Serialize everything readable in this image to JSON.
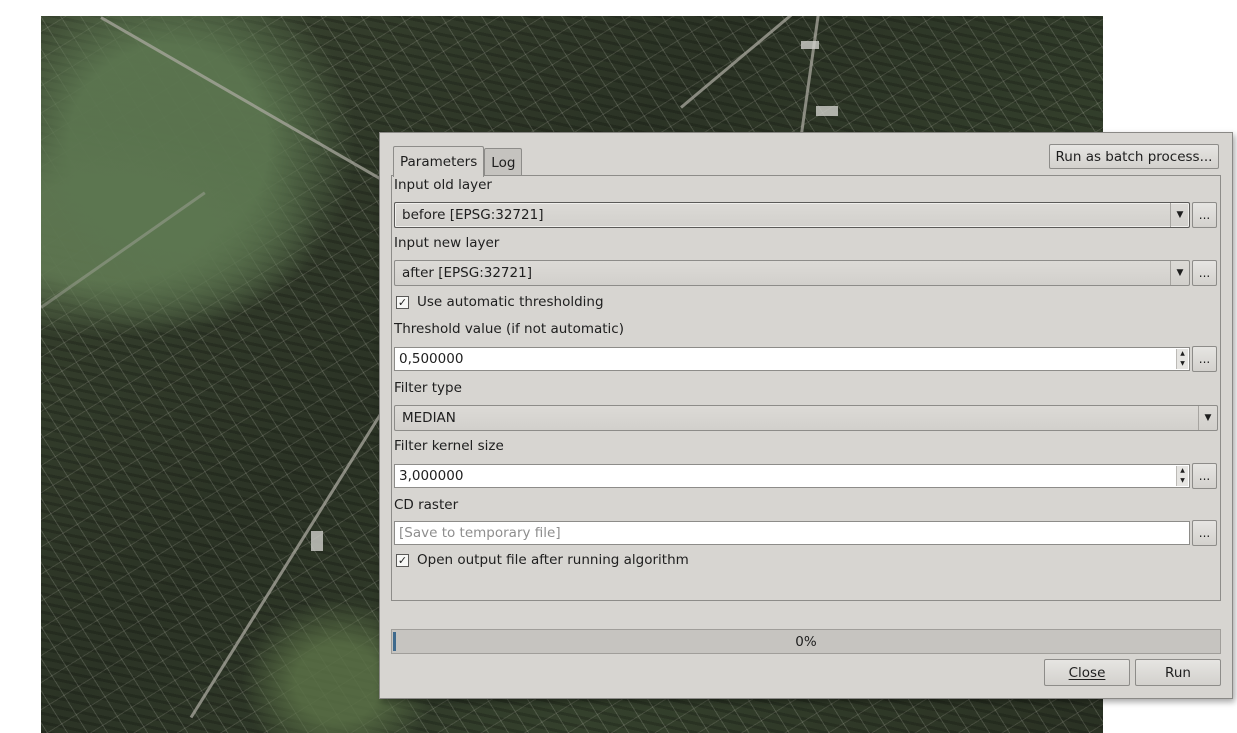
{
  "tabs": [
    {
      "label": "Parameters",
      "active": true
    },
    {
      "label": "Log",
      "active": false
    }
  ],
  "batch_button": "Run as batch process...",
  "browse_label": "...",
  "params": {
    "old_layer": {
      "label": "Input old layer",
      "value": "before [EPSG:32721]"
    },
    "new_layer": {
      "label": "Input new layer",
      "value": "after [EPSG:32721]"
    },
    "auto_threshold": {
      "label": "Use automatic thresholding",
      "checked": true
    },
    "threshold": {
      "label": "Threshold value (if not automatic)",
      "value": "0,500000"
    },
    "filter_type": {
      "label": "Filter type",
      "value": "MEDIAN"
    },
    "kernel_size": {
      "label": "Filter kernel size",
      "value": "3,000000"
    },
    "cd_raster": {
      "label": "CD raster",
      "placeholder": "[Save to temporary file]"
    },
    "open_output": {
      "label": "Open output file after running algorithm",
      "checked": true
    }
  },
  "progress": {
    "text": "0%",
    "value": 0
  },
  "buttons": {
    "close": "Close",
    "run": "Run"
  },
  "colors": {
    "dialog_bg": "#d7d5d1",
    "progress_fill": "#3f6a8d"
  }
}
